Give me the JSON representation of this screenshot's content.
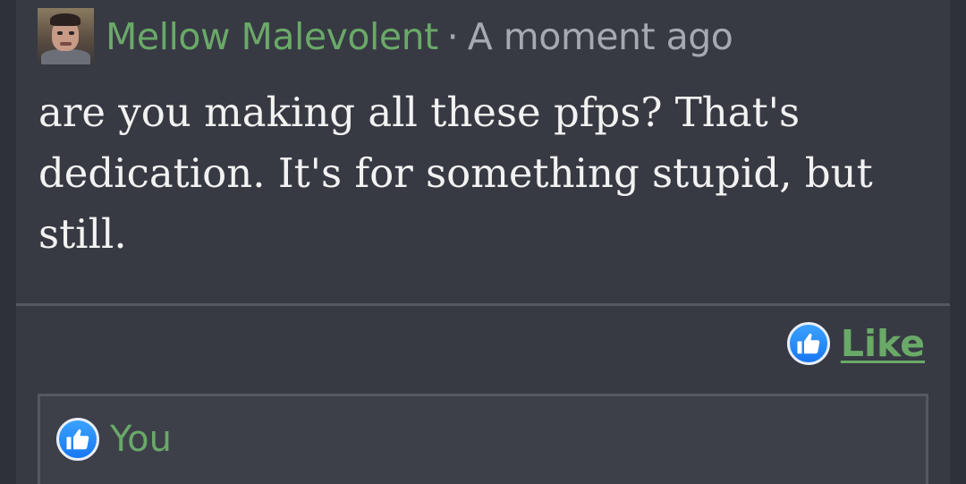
{
  "comment": {
    "author": "Mellow Malevolent",
    "separator": "·",
    "timestamp": "A moment ago",
    "text": "are you making all these pfps? That's dedication. It's for something stupid, but still."
  },
  "actions": {
    "like_label": "Like",
    "like_icon": "thumbs-up-icon"
  },
  "likes": {
    "users": [
      "You"
    ]
  },
  "colors": {
    "accent_green": "#6aa968",
    "like_blue": "#1877f2",
    "background": "#373a43",
    "muted_text": "#a6a9b0"
  }
}
